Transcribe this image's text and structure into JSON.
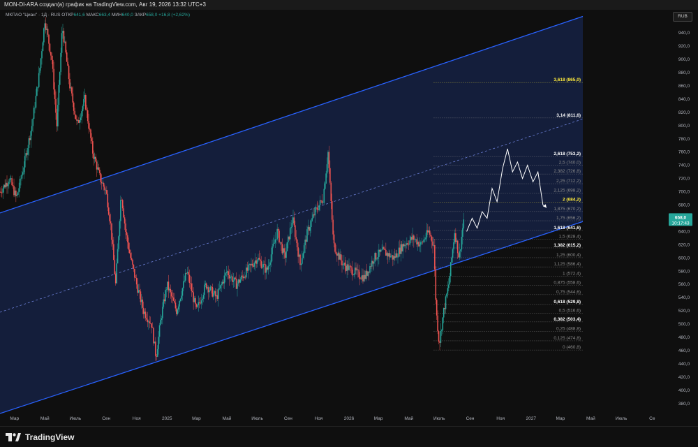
{
  "header": {
    "title": "MON-DI-ARA создал(а) график на TradingView.com, Авг 19, 2026 13:32 UTC+3"
  },
  "legend": {
    "symbol": "МКПАО \"Циан\" · 1Д · RUS",
    "open_label": "ОТКР",
    "open": "641,6",
    "high_label": "МАКС",
    "high": "663,4",
    "low_label": "МИН",
    "low": "640,0",
    "close_label": "ЗАКР",
    "close": "658,0",
    "change": "+16,8 (+2,62%)"
  },
  "currency": "RUB",
  "footer": {
    "logo_text": "TradingView"
  },
  "price_tag": {
    "price": "658,0",
    "timer": "10:17:43"
  },
  "colors": {
    "background": "#0f0f0f",
    "up": "#26a69a",
    "down": "#ef5350",
    "channel": "#2962ff",
    "channel_fill": "#152040",
    "fib_highlight": "#ffeb3b",
    "forecast": "#ffffff"
  },
  "chart_data": {
    "type": "candlestick",
    "symbol": "МКПАО \"Циан\"",
    "timeframe": "1Д",
    "y_axis": {
      "range": [
        365,
        975
      ],
      "ticks": [
        380,
        400,
        420,
        440,
        460,
        480,
        500,
        520,
        540,
        560,
        580,
        600,
        620,
        640,
        660,
        680,
        700,
        720,
        740,
        760,
        780,
        800,
        820,
        840,
        860,
        880,
        900,
        920,
        940
      ],
      "tick_labels": [
        "380,0",
        "400,0",
        "420,0",
        "440,0",
        "460,0",
        "480,0",
        "500,0",
        "520,0",
        "540,0",
        "560,0",
        "580,0",
        "600,0",
        "620,0",
        "640,0",
        "660,0",
        "680,0",
        "700,0",
        "720,0",
        "740,0",
        "760,0",
        "780,0",
        "800,0",
        "820,0",
        "840,0",
        "860,0",
        "880,0",
        "900,0",
        "920,0",
        "940,0"
      ]
    },
    "x_axis": {
      "range": [
        "2024-02-01",
        "2027-09-30"
      ],
      "labels": [
        {
          "date": "2024-03-01",
          "label": "Мар"
        },
        {
          "date": "2024-05-01",
          "label": "Май"
        },
        {
          "date": "2024-07-01",
          "label": "Июль"
        },
        {
          "date": "2024-09-01",
          "label": "Сен"
        },
        {
          "date": "2024-11-01",
          "label": "Ноя"
        },
        {
          "date": "2025-01-01",
          "label": "2025"
        },
        {
          "date": "2025-03-01",
          "label": "Мар"
        },
        {
          "date": "2025-05-01",
          "label": "Май"
        },
        {
          "date": "2025-07-01",
          "label": "Июль"
        },
        {
          "date": "2025-09-01",
          "label": "Сен"
        },
        {
          "date": "2025-11-01",
          "label": "Ноя"
        },
        {
          "date": "2026-01-01",
          "label": "2026"
        },
        {
          "date": "2026-03-01",
          "label": "Мар"
        },
        {
          "date": "2026-05-01",
          "label": "Май"
        },
        {
          "date": "2026-07-01",
          "label": "Июль"
        },
        {
          "date": "2026-09-01",
          "label": "Сен"
        },
        {
          "date": "2026-11-01",
          "label": "Ноя"
        },
        {
          "date": "2027-01-01",
          "label": "2027"
        },
        {
          "date": "2027-03-01",
          "label": "Мар"
        },
        {
          "date": "2027-05-01",
          "label": "Май"
        },
        {
          "date": "2027-07-01",
          "label": "Июль"
        },
        {
          "date": "2027-09-01",
          "label": "Се"
        }
      ]
    },
    "price_path": [
      {
        "date": "2024-02-01",
        "price": 700
      },
      {
        "date": "2024-02-20",
        "price": 720
      },
      {
        "date": "2024-03-05",
        "price": 690
      },
      {
        "date": "2024-03-20",
        "price": 740
      },
      {
        "date": "2024-04-05",
        "price": 800
      },
      {
        "date": "2024-04-20",
        "price": 880
      },
      {
        "date": "2024-05-01",
        "price": 960
      },
      {
        "date": "2024-05-15",
        "price": 900
      },
      {
        "date": "2024-05-25",
        "price": 800
      },
      {
        "date": "2024-06-05",
        "price": 950
      },
      {
        "date": "2024-06-20",
        "price": 860
      },
      {
        "date": "2024-07-05",
        "price": 800
      },
      {
        "date": "2024-07-20",
        "price": 840
      },
      {
        "date": "2024-08-05",
        "price": 760
      },
      {
        "date": "2024-08-20",
        "price": 720
      },
      {
        "date": "2024-09-01",
        "price": 700
      },
      {
        "date": "2024-09-10",
        "price": 650
      },
      {
        "date": "2024-09-20",
        "price": 560
      },
      {
        "date": "2024-10-01",
        "price": 700
      },
      {
        "date": "2024-10-10",
        "price": 640
      },
      {
        "date": "2024-10-20",
        "price": 600
      },
      {
        "date": "2024-11-01",
        "price": 560
      },
      {
        "date": "2024-11-15",
        "price": 520
      },
      {
        "date": "2024-12-01",
        "price": 500
      },
      {
        "date": "2024-12-10",
        "price": 450
      },
      {
        "date": "2024-12-20",
        "price": 510
      },
      {
        "date": "2025-01-01",
        "price": 560
      },
      {
        "date": "2025-01-20",
        "price": 520
      },
      {
        "date": "2025-02-10",
        "price": 580
      },
      {
        "date": "2025-03-01",
        "price": 520
      },
      {
        "date": "2025-03-20",
        "price": 560
      },
      {
        "date": "2025-04-10",
        "price": 540
      },
      {
        "date": "2025-05-01",
        "price": 580
      },
      {
        "date": "2025-05-20",
        "price": 560
      },
      {
        "date": "2025-06-10",
        "price": 580
      },
      {
        "date": "2025-07-01",
        "price": 600
      },
      {
        "date": "2025-07-20",
        "price": 580
      },
      {
        "date": "2025-08-10",
        "price": 640
      },
      {
        "date": "2025-08-25",
        "price": 600
      },
      {
        "date": "2025-09-10",
        "price": 660
      },
      {
        "date": "2025-09-25",
        "price": 590
      },
      {
        "date": "2025-10-10",
        "price": 640
      },
      {
        "date": "2025-10-25",
        "price": 670
      },
      {
        "date": "2025-11-10",
        "price": 690
      },
      {
        "date": "2025-11-20",
        "price": 760
      },
      {
        "date": "2025-12-01",
        "price": 620
      },
      {
        "date": "2025-12-20",
        "price": 590
      },
      {
        "date": "2026-01-10",
        "price": 580
      },
      {
        "date": "2026-02-01",
        "price": 570
      },
      {
        "date": "2026-02-20",
        "price": 600
      },
      {
        "date": "2026-03-10",
        "price": 610
      },
      {
        "date": "2026-04-01",
        "price": 600
      },
      {
        "date": "2026-04-20",
        "price": 620
      },
      {
        "date": "2026-05-10",
        "price": 630
      },
      {
        "date": "2026-05-25",
        "price": 620
      },
      {
        "date": "2026-06-10",
        "price": 640
      },
      {
        "date": "2026-06-20",
        "price": 620
      },
      {
        "date": "2026-06-25",
        "price": 520
      },
      {
        "date": "2026-07-01",
        "price": 470
      },
      {
        "date": "2026-07-10",
        "price": 520
      },
      {
        "date": "2026-07-20",
        "price": 560
      },
      {
        "date": "2026-08-01",
        "price": 640
      },
      {
        "date": "2026-08-10",
        "price": 600
      },
      {
        "date": "2026-08-19",
        "price": 658
      }
    ],
    "forecast_path": [
      {
        "date": "2026-08-25",
        "price": 640
      },
      {
        "date": "2026-09-05",
        "price": 660
      },
      {
        "date": "2026-09-15",
        "price": 645
      },
      {
        "date": "2026-09-25",
        "price": 670
      },
      {
        "date": "2026-10-05",
        "price": 660
      },
      {
        "date": "2026-10-15",
        "price": 705
      },
      {
        "date": "2026-10-25",
        "price": 685
      },
      {
        "date": "2026-11-05",
        "price": 735
      },
      {
        "date": "2026-11-15",
        "price": 765
      },
      {
        "date": "2026-11-25",
        "price": 730
      },
      {
        "date": "2026-12-05",
        "price": 745
      },
      {
        "date": "2026-12-15",
        "price": 720
      },
      {
        "date": "2026-12-25",
        "price": 740
      },
      {
        "date": "2027-01-05",
        "price": 715
      },
      {
        "date": "2027-01-15",
        "price": 730
      },
      {
        "date": "2027-01-25",
        "price": 680
      },
      {
        "date": "2027-02-01",
        "price": 676
      }
    ],
    "channel": {
      "start_date": "2024-02-01",
      "end_date": "2027-04-15",
      "upper": [
        668,
        965
      ],
      "lower": [
        365,
        655
      ],
      "mid": [
        518,
        810
      ]
    },
    "fibonacci": {
      "start_date": "2026-06-20",
      "end_date": "2027-04-15",
      "levels": [
        {
          "ratio": "0",
          "price": 460.8,
          "label": "0 (460,8)",
          "highlight": false
        },
        {
          "ratio": "0,125",
          "price": 474.8,
          "label": "0,125 (474,8)",
          "highlight": false
        },
        {
          "ratio": "0,25",
          "price": 488.8,
          "label": "0,25 (488,8)",
          "highlight": false
        },
        {
          "ratio": "0,382",
          "price": 503.4,
          "label": "0,382 (503,4)",
          "highlight": true
        },
        {
          "ratio": "0,5",
          "price": 516.6,
          "label": "0,5 (516,6)",
          "highlight": false
        },
        {
          "ratio": "0,618",
          "price": 529.8,
          "label": "0,618 (529,8)",
          "highlight": true
        },
        {
          "ratio": "0,75",
          "price": 544.6,
          "label": "0,75 (544,6)",
          "highlight": false
        },
        {
          "ratio": "0,875",
          "price": 558.6,
          "label": "0,875 (558,6)",
          "highlight": false
        },
        {
          "ratio": "1",
          "price": 572.4,
          "label": "1 (572,4)",
          "highlight": false
        },
        {
          "ratio": "1,125",
          "price": 586.4,
          "label": "1,125 (586,4)",
          "highlight": false
        },
        {
          "ratio": "1,25",
          "price": 600.4,
          "label": "1,25 (600,4)",
          "highlight": false
        },
        {
          "ratio": "1,382",
          "price": 615.2,
          "label": "1,382 (615,2)",
          "highlight": true
        },
        {
          "ratio": "1,5",
          "price": 628.4,
          "label": "1,5 (628,4)",
          "highlight": false
        },
        {
          "ratio": "1,618",
          "price": 641.6,
          "label": "1,618 (641,6)",
          "highlight": true
        },
        {
          "ratio": "1,75",
          "price": 656.2,
          "label": "1,75 (656,2)",
          "highlight": false
        },
        {
          "ratio": "1,875",
          "price": 670.2,
          "label": "1,875 (670,2)",
          "highlight": false
        },
        {
          "ratio": "2",
          "price": 684.2,
          "label": "2 (684,2)",
          "highlight": "yellow"
        },
        {
          "ratio": "2,125",
          "price": 698.2,
          "label": "2,125 (698,2)",
          "highlight": false
        },
        {
          "ratio": "2,25",
          "price": 712.2,
          "label": "2,25 (712,2)",
          "highlight": false
        },
        {
          "ratio": "2,382",
          "price": 726.8,
          "label": "2,382 (726,8)",
          "highlight": false
        },
        {
          "ratio": "2,5",
          "price": 740.0,
          "label": "2,5 (740,0)",
          "highlight": false
        },
        {
          "ratio": "2,618",
          "price": 753.2,
          "label": "2,618 (753,2)",
          "highlight": true
        },
        {
          "ratio": "3,14",
          "price": 811.6,
          "label": "3,14 (811,6)",
          "highlight": true
        },
        {
          "ratio": "3,618",
          "price": 865.0,
          "label": "3,618 (865,0)",
          "highlight": "yellow"
        }
      ]
    }
  }
}
